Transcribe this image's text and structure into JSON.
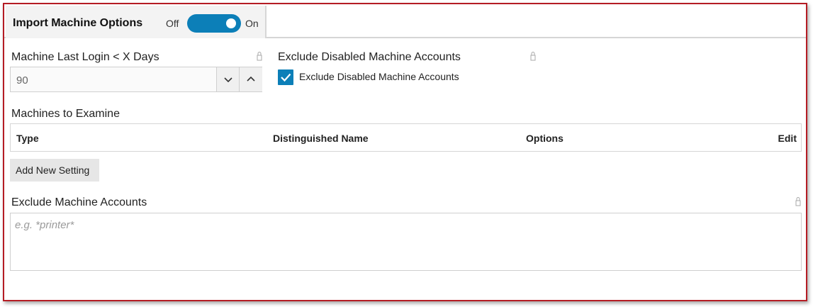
{
  "tab": {
    "title": "Import Machine Options",
    "toggle_off_label": "Off",
    "toggle_on_label": "On",
    "toggle_state": "on"
  },
  "last_login": {
    "label": "Machine Last Login < X Days",
    "value": "90"
  },
  "exclude_disabled": {
    "label": "Exclude Disabled Machine Accounts",
    "checkbox_label": "Exclude Disabled Machine Accounts",
    "checked": true
  },
  "machines": {
    "label": "Machines to Examine",
    "columns": [
      "Type",
      "Distinguished Name",
      "Options",
      "Edit"
    ]
  },
  "add_button_label": "Add New Setting",
  "exclude_accounts": {
    "label": "Exclude Machine Accounts",
    "placeholder": "e.g. *printer*"
  },
  "colors": {
    "accent": "#0c7fb8",
    "frame_border": "#b51c24"
  }
}
